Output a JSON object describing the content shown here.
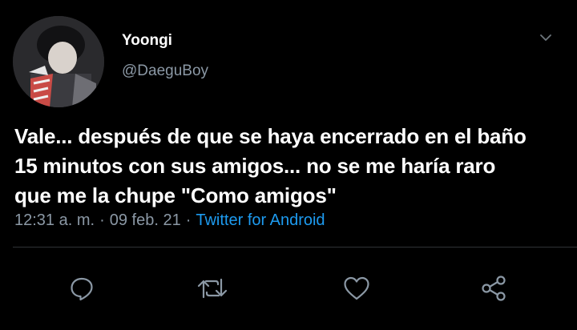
{
  "tweet": {
    "display_name": "Yoongi",
    "handle": "@DaeguBoy",
    "text": "Vale... después de que se haya encerrado en el baño\n15 minutos con sus amigos... no se me haría raro\nque me la chupe \"Como amigos\"",
    "time": "12:31 a. m.",
    "date": "09 feb. 21",
    "separator": "·",
    "source": "Twitter for Android"
  },
  "icons": {
    "caret": "chevron-down-icon",
    "reply": "reply-icon",
    "retweet": "retweet-icon",
    "like": "heart-icon",
    "share": "share-icon"
  },
  "colors": {
    "background": "#000000",
    "text": "#ffffff",
    "secondary": "#8b98a5",
    "link": "#1d9bf0"
  }
}
